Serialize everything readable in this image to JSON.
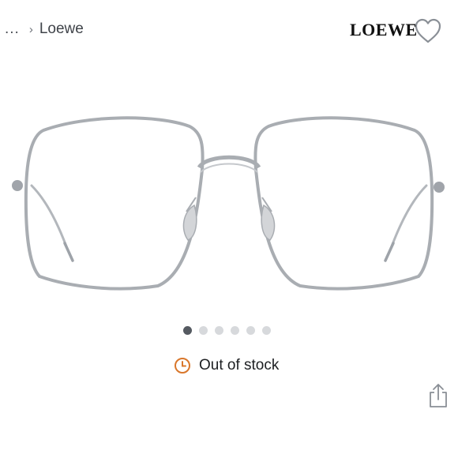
{
  "breadcrumb": {
    "ellipsis": "...",
    "separator": "›",
    "current": "Loewe"
  },
  "brand": {
    "logo_text": "LOEWE"
  },
  "icons": {
    "favorite": "heart-outline-icon",
    "share": "share-icon",
    "status": "clock-icon"
  },
  "gallery": {
    "image_alt": "Silver wire-frame oversized square eyeglasses",
    "dot_count": 6,
    "active_index": 0
  },
  "stock": {
    "label": "Out of stock"
  },
  "colors": {
    "status_orange": "#d9772b",
    "frame_silver": "#a9adb2",
    "dot_active": "#555a61",
    "dot_inactive": "#d7d9dc"
  }
}
